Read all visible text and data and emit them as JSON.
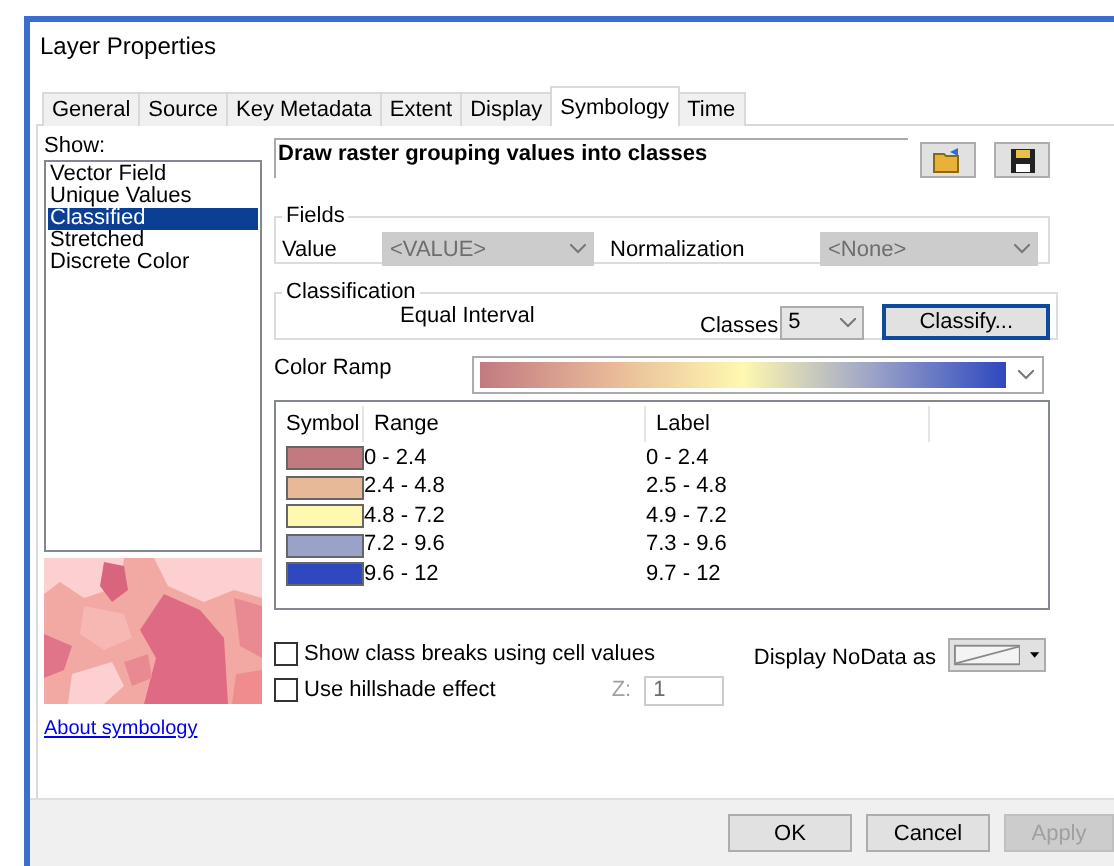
{
  "window": {
    "title": "Layer Properties"
  },
  "tabs": [
    {
      "label": "General",
      "selected": false
    },
    {
      "label": "Source",
      "selected": false
    },
    {
      "label": "Key Metadata",
      "selected": false
    },
    {
      "label": "Extent",
      "selected": false
    },
    {
      "label": "Display",
      "selected": false
    },
    {
      "label": "Symbology",
      "selected": true
    },
    {
      "label": "Time",
      "selected": false
    }
  ],
  "show": {
    "label": "Show:",
    "items": [
      {
        "label": "Vector Field",
        "selected": false
      },
      {
        "label": "Unique Values",
        "selected": false
      },
      {
        "label": "Classified",
        "selected": true
      },
      {
        "label": "Stretched",
        "selected": false
      },
      {
        "label": "Discrete Color",
        "selected": false
      }
    ]
  },
  "about_link": "About symbology",
  "description": "Draw raster grouping values into classes",
  "fields": {
    "title": "Fields",
    "value_label": "Value",
    "value": "<VALUE>",
    "normalization_label": "Normalization",
    "normalization": "<None>",
    "disabled": true
  },
  "classification": {
    "title": "Classification",
    "method": "Equal Interval",
    "classes_label": "Classes",
    "classes": "5",
    "button": "Classify..."
  },
  "color_ramp": {
    "label": "Color Ramp"
  },
  "table": {
    "columns": [
      "Symbol",
      "Range",
      "Label"
    ],
    "rows": [
      {
        "color": "#c27a80",
        "range": "0 - 2.4",
        "label": "0 - 2.4"
      },
      {
        "color": "#e8b998",
        "range": "2.4 - 4.8",
        "label": "2.5 - 4.8"
      },
      {
        "color": "#fff8b0",
        "range": "4.8 - 7.2",
        "label": "4.9 - 7.2"
      },
      {
        "color": "#9aa2c8",
        "range": "7.2 - 9.6",
        "label": "7.3 - 9.6"
      },
      {
        "color": "#2e48bf",
        "range": "9.6 - 12",
        "label": "9.7 - 12"
      }
    ]
  },
  "options": [
    {
      "label": "Show class breaks using cell values",
      "checked": false
    },
    {
      "label": "Use hillshade effect",
      "checked": false
    }
  ],
  "z": {
    "label": "Z:",
    "value": "1",
    "disabled": true
  },
  "nodata": {
    "label": "Display NoData as"
  },
  "buttons": [
    {
      "label": "OK",
      "disabled": false
    },
    {
      "label": "Cancel",
      "disabled": false
    },
    {
      "label": "Apply",
      "disabled": true
    }
  ]
}
